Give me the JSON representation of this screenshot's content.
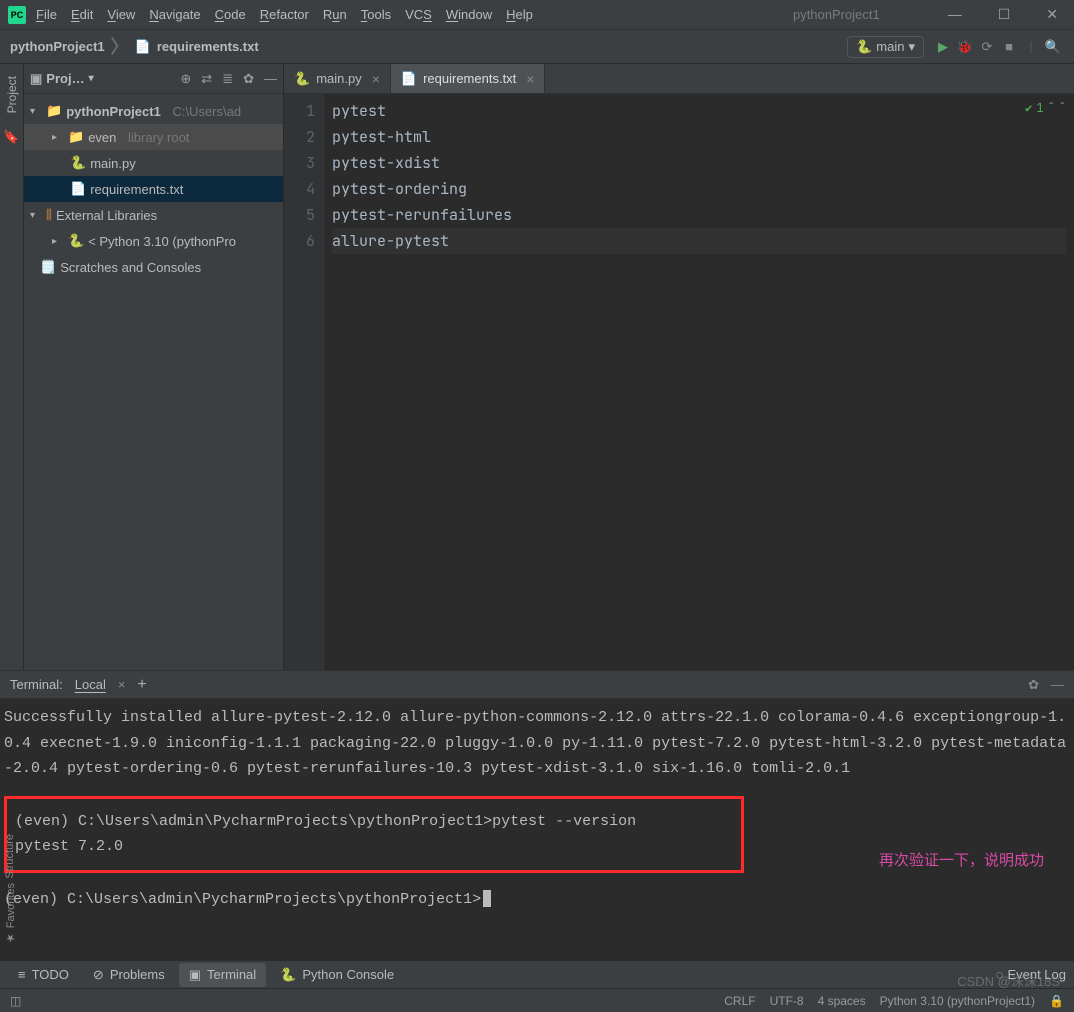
{
  "app": {
    "icon_text": "PC",
    "window_title": "pythonProject1"
  },
  "menu": [
    "File",
    "Edit",
    "View",
    "Navigate",
    "Code",
    "Refactor",
    "Run",
    "Tools",
    "VCS",
    "Window",
    "Help"
  ],
  "window_controls": {
    "min": "—",
    "max": "☐",
    "close": "✕"
  },
  "breadcrumb": {
    "project": "pythonProject1",
    "file": "requirements.txt"
  },
  "run_config": {
    "name": "main",
    "arrow": "▾"
  },
  "project_panel": {
    "title": "Proj…",
    "dropdown": "▾",
    "header_icons": {
      "target": "⊕",
      "select": "⇄",
      "collapse": "≣",
      "gear": "✿",
      "hide": "—"
    },
    "tree": {
      "root": {
        "name": "pythonProject1",
        "path": "C:\\Users\\ad"
      },
      "even": {
        "name": "even",
        "tag": "library root"
      },
      "main_py": "main.py",
      "requirements": "requirements.txt",
      "ext_libs": "External Libraries",
      "python_sdk": "< Python 3.10 (pythonPro",
      "scratches": "Scratches and Consoles"
    }
  },
  "tabs": [
    {
      "icon": "py",
      "label": "main.py",
      "active": false
    },
    {
      "icon": "txt",
      "label": "requirements.txt",
      "active": true
    }
  ],
  "editor": {
    "lines": [
      "pytest",
      "pytest-html",
      "pytest-xdist",
      "pytest-ordering",
      "pytest-rerunfailures",
      "allure-pytest"
    ],
    "status_count": "1"
  },
  "terminal": {
    "title": "Terminal:",
    "tab": "Local",
    "close_tab": "×",
    "output": "Successfully installed allure-pytest-2.12.0 allure-python-commons-2.12.0 attrs-22.1.0 colorama-0.4.6 exceptiongroup-1.0.4 execnet-1.9.0 iniconfig-1.1.1 packaging-22.0 pluggy-1.0.0 py-1.11.0 pytest-7.2.0 pytest-html-3.2.0 pytest-metadata-2.0.4 pytest-ordering-0.6 pytest-rerunfailures-10.3 pytest-xdist-3.1.0 six-1.16.0 tomli-2.0.1",
    "cmd1": "(even) C:\\Users\\admin\\PycharmProjects\\pythonProject1>pytest --version",
    "cmd1_out": "pytest 7.2.0",
    "annotation": "再次验证一下，说明成功",
    "cmd2": "(even) C:\\Users\\admin\\PycharmProjects\\pythonProject1>"
  },
  "tool_tabs": {
    "todo": "TODO",
    "problems": "Problems",
    "terminal": "Terminal",
    "python_console": "Python Console",
    "event_log": "Event Log"
  },
  "statusbar": {
    "crlf": "CRLF",
    "encoding": "UTF-8",
    "indent": "4 spaces",
    "sdk": "Python 3.10 (pythonProject1)"
  },
  "watermark": "CSDN @沫沫18S"
}
